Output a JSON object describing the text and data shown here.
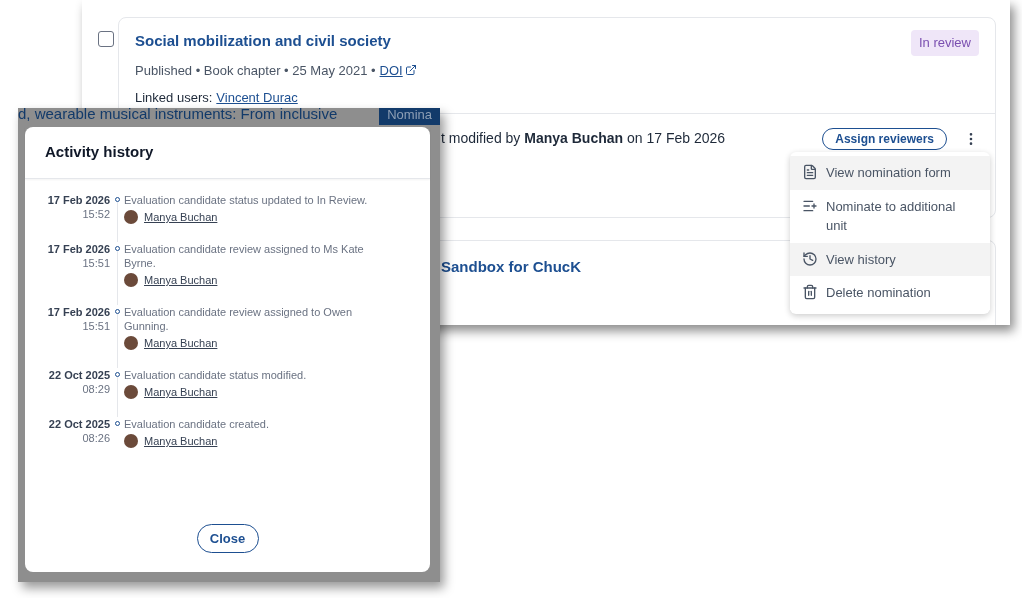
{
  "publication": {
    "checked": false,
    "title": "Social mobilization and civil society",
    "status": "In review",
    "meta": "Published • Book chapter • 25 May 2021 •",
    "doi": "DOI",
    "linked_label": "Linked users:",
    "linked_user": "Vincent Durac",
    "modified": "t modified by **Manya Buchan** on 17 Feb 2026",
    "assign_button": "Assign reviewers"
  },
  "menu": [
    {
      "label": "View nomination form",
      "selected": true
    },
    {
      "label": "Nominate to additional unit",
      "selected": false
    },
    {
      "label": "View history",
      "selected": true
    },
    {
      "label": "Delete nomination",
      "selected": false
    }
  ],
  "second_title": "Sandbox for ChucK",
  "background": {
    "title_fragment": "d, wearable musical instruments: From inclusive",
    "badge_fragment": "Nomina"
  },
  "dialog": {
    "title": "Activity history",
    "close": "Close",
    "events": [
      {
        "date": "17 Feb 2026",
        "time": "15:52",
        "text": "Evaluation candidate status updated to In Review.",
        "user": "Manya Buchan"
      },
      {
        "date": "17 Feb 2026",
        "time": "15:51",
        "text": "Evaluation candidate review assigned to Ms Kate Byrne.",
        "user": "Manya Buchan"
      },
      {
        "date": "17 Feb 2026",
        "time": "15:51",
        "text": "Evaluation candidate review assigned to Owen Gunning.",
        "user": "Manya Buchan"
      },
      {
        "date": "22 Oct 2025",
        "time": "08:29",
        "text": "Evaluation candidate status modified.",
        "user": "Manya Buchan"
      },
      {
        "date": "22 Oct 2025",
        "time": "08:26",
        "text": "Evaluation candidate created.",
        "user": "Manya Buchan"
      }
    ]
  }
}
